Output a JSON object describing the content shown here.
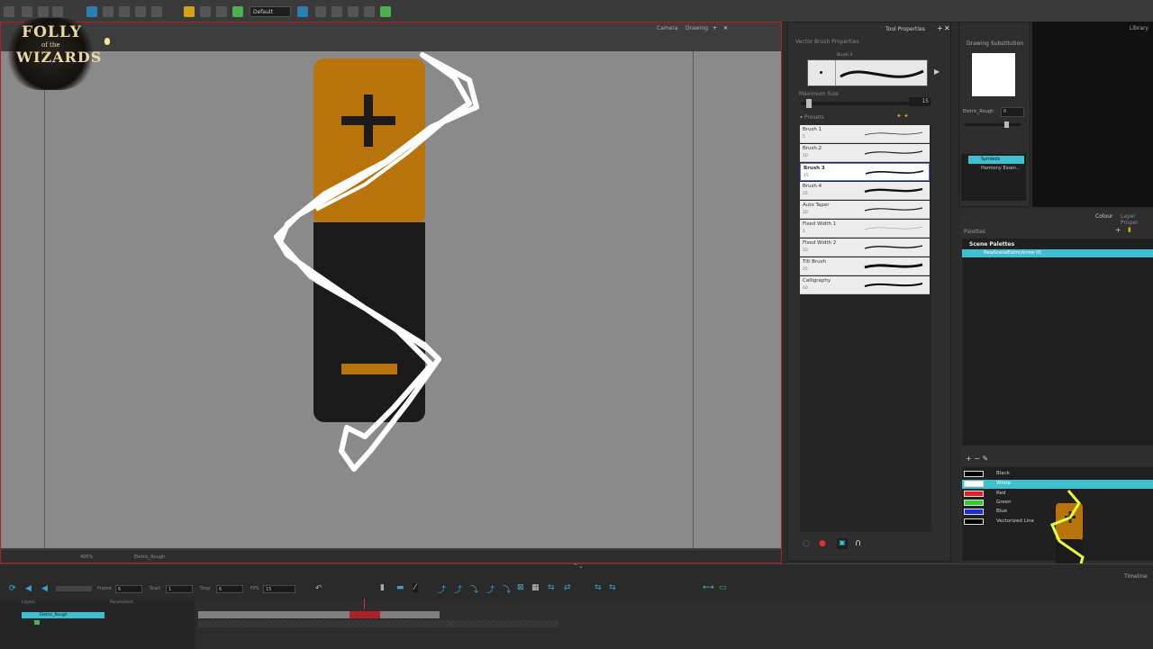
{
  "toolbar": {
    "preset": "Default"
  },
  "viewport": {
    "tabs": [
      "Camera",
      "Drawing"
    ]
  },
  "logo": {
    "line1": "FOLLY",
    "line2": "of the",
    "line3": "WIZARDS"
  },
  "tool_properties": {
    "title": "Tool Properties",
    "section": "Vector Brush Properties",
    "brush_label": "Brush 3",
    "max_size_label": "Maximum Size",
    "max_size_value": "15",
    "presets_label": "Presets",
    "presets": [
      {
        "name": "Brush 1",
        "size": "5"
      },
      {
        "name": "Brush 2",
        "size": "10"
      },
      {
        "name": "Brush 3",
        "size": "15"
      },
      {
        "name": "Brush 4",
        "size": "25"
      },
      {
        "name": "Auto Taper",
        "size": "10"
      },
      {
        "name": "Fixed Width 1",
        "size": "1"
      },
      {
        "name": "Fixed Width 2",
        "size": "10"
      },
      {
        "name": "Tilt Brush",
        "size": "25"
      },
      {
        "name": "Calligraphy",
        "size": "40"
      }
    ],
    "selected_preset": "Brush 3"
  },
  "drawing_substitution": {
    "title": "Drawing Substitution",
    "drawing_name": "Eletric_Rough",
    "drawing_value": "6"
  },
  "library": {
    "title": "Library",
    "items": [
      "Symbols",
      "Harmony Essen..."
    ]
  },
  "colour": {
    "tabs": [
      "Colour",
      "Layer Proper"
    ],
    "palettes_label": "Palettes",
    "scene_palettes_label": "Scene Palettes",
    "palette_name": "NewSceneEletricArrow 01",
    "swatches": [
      {
        "name": "Black",
        "color": "#000000"
      },
      {
        "name": "White",
        "color": "#ffffff"
      },
      {
        "name": "Red",
        "color": "#e0202a"
      },
      {
        "name": "Green",
        "color": "#2ad12a"
      },
      {
        "name": "Blue",
        "color": "#1a2ae0"
      },
      {
        "name": "Vectorized Line",
        "color": "#000000"
      }
    ],
    "selected_swatch": "White"
  },
  "timeline": {
    "title": "Timeline",
    "frame_label": "Frame",
    "frame_value": "6",
    "start_label": "Start",
    "start_value": "1",
    "stop_label": "Stop",
    "stop_value": "6",
    "fps_label": "FPS",
    "fps_value": "15",
    "layers_label": "Layers",
    "parameters_label": "Parameters",
    "layers": [
      "Eletric_Rough"
    ]
  },
  "status": {
    "zoom": "400%",
    "layer": "Eletric_Rough"
  },
  "colors": {
    "battery_orange": "#b8730b",
    "battery_black": "#1a1a1a",
    "selection_cyan": "#3fbfd0",
    "viewport_border": "#b02020",
    "stroke_white": "#ffffff",
    "glow_yellow": "#e8ff3a"
  }
}
